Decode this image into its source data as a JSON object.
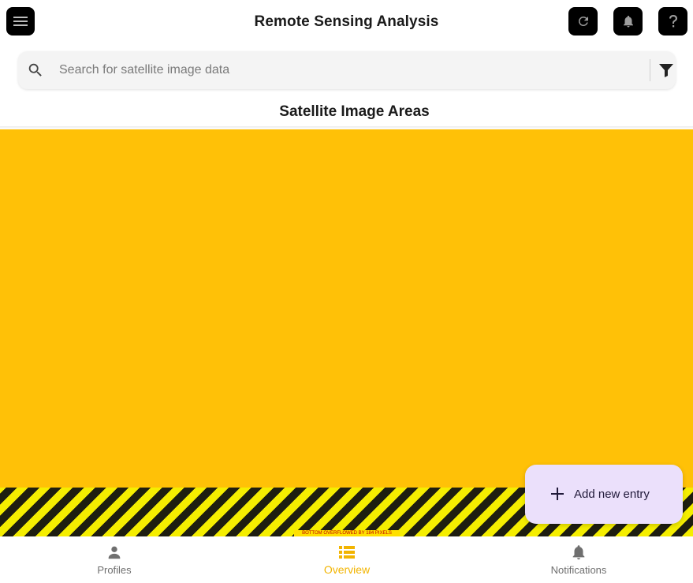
{
  "app_bar": {
    "title": "Remote Sensing Analysis",
    "icons": [
      "menu-icon",
      "refresh-icon",
      "bell-icon",
      "help-icon"
    ]
  },
  "search": {
    "placeholder": "Search for satellite image data",
    "value": ""
  },
  "section": {
    "title": "Satellite Image Areas"
  },
  "overflow_warning": "BOTTOM OVERFLOWED BY 184 PIXELS",
  "fab": {
    "label": "Add new entry",
    "icon": "plus-icon"
  },
  "bottom_nav": {
    "selected": "Overview",
    "items": [
      {
        "label": "Profiles",
        "icon": "person-icon"
      },
      {
        "label": "Overview",
        "icon": "list-icon"
      },
      {
        "label": "Notifications",
        "icon": "bell-icon"
      }
    ]
  },
  "colors": {
    "accent": "#ffc107",
    "selected_nav": "#f2b400",
    "fab_bg": "#ebe0fb",
    "icon_button_bg": "#000000"
  }
}
